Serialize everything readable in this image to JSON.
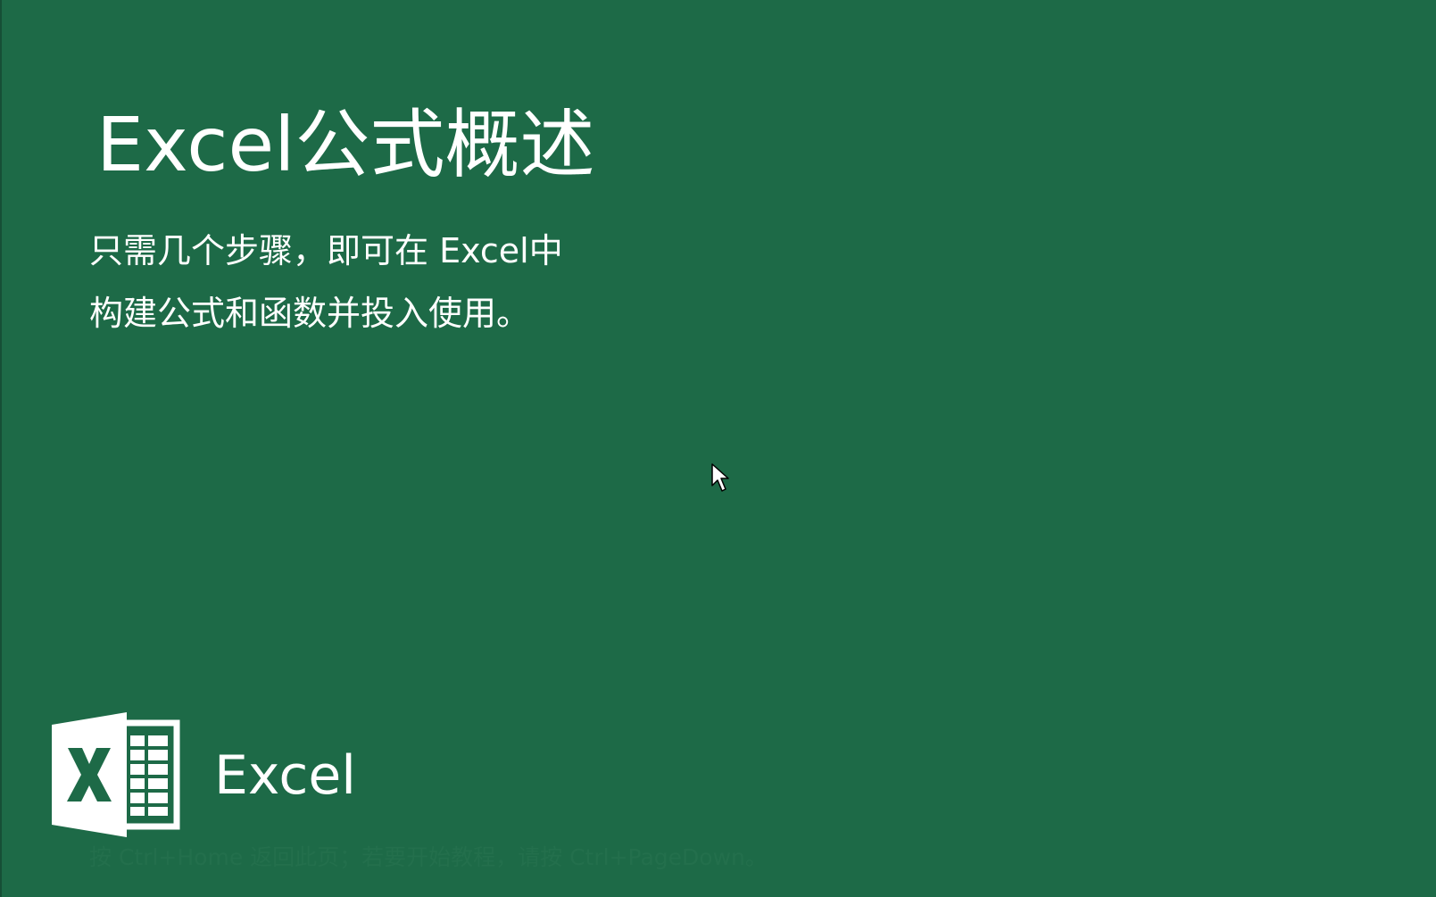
{
  "slide": {
    "title": "Excel公式概述",
    "subtitle_lines": [
      "只需几个步骤，即可在 Excel中",
      "构建公式和函数并投入使用。"
    ],
    "brand_name": "Excel",
    "logo_icon": "excel-logo-icon",
    "navigation_hint": "按 Ctrl+Home 返回此页；若要开始教程，请按 Ctrl+PageDown。"
  },
  "colors": {
    "background": "#1d6a47",
    "text": "#ffffff",
    "hint_text": "#236f4c"
  },
  "cursor": {
    "icon": "mouse-pointer-icon"
  }
}
